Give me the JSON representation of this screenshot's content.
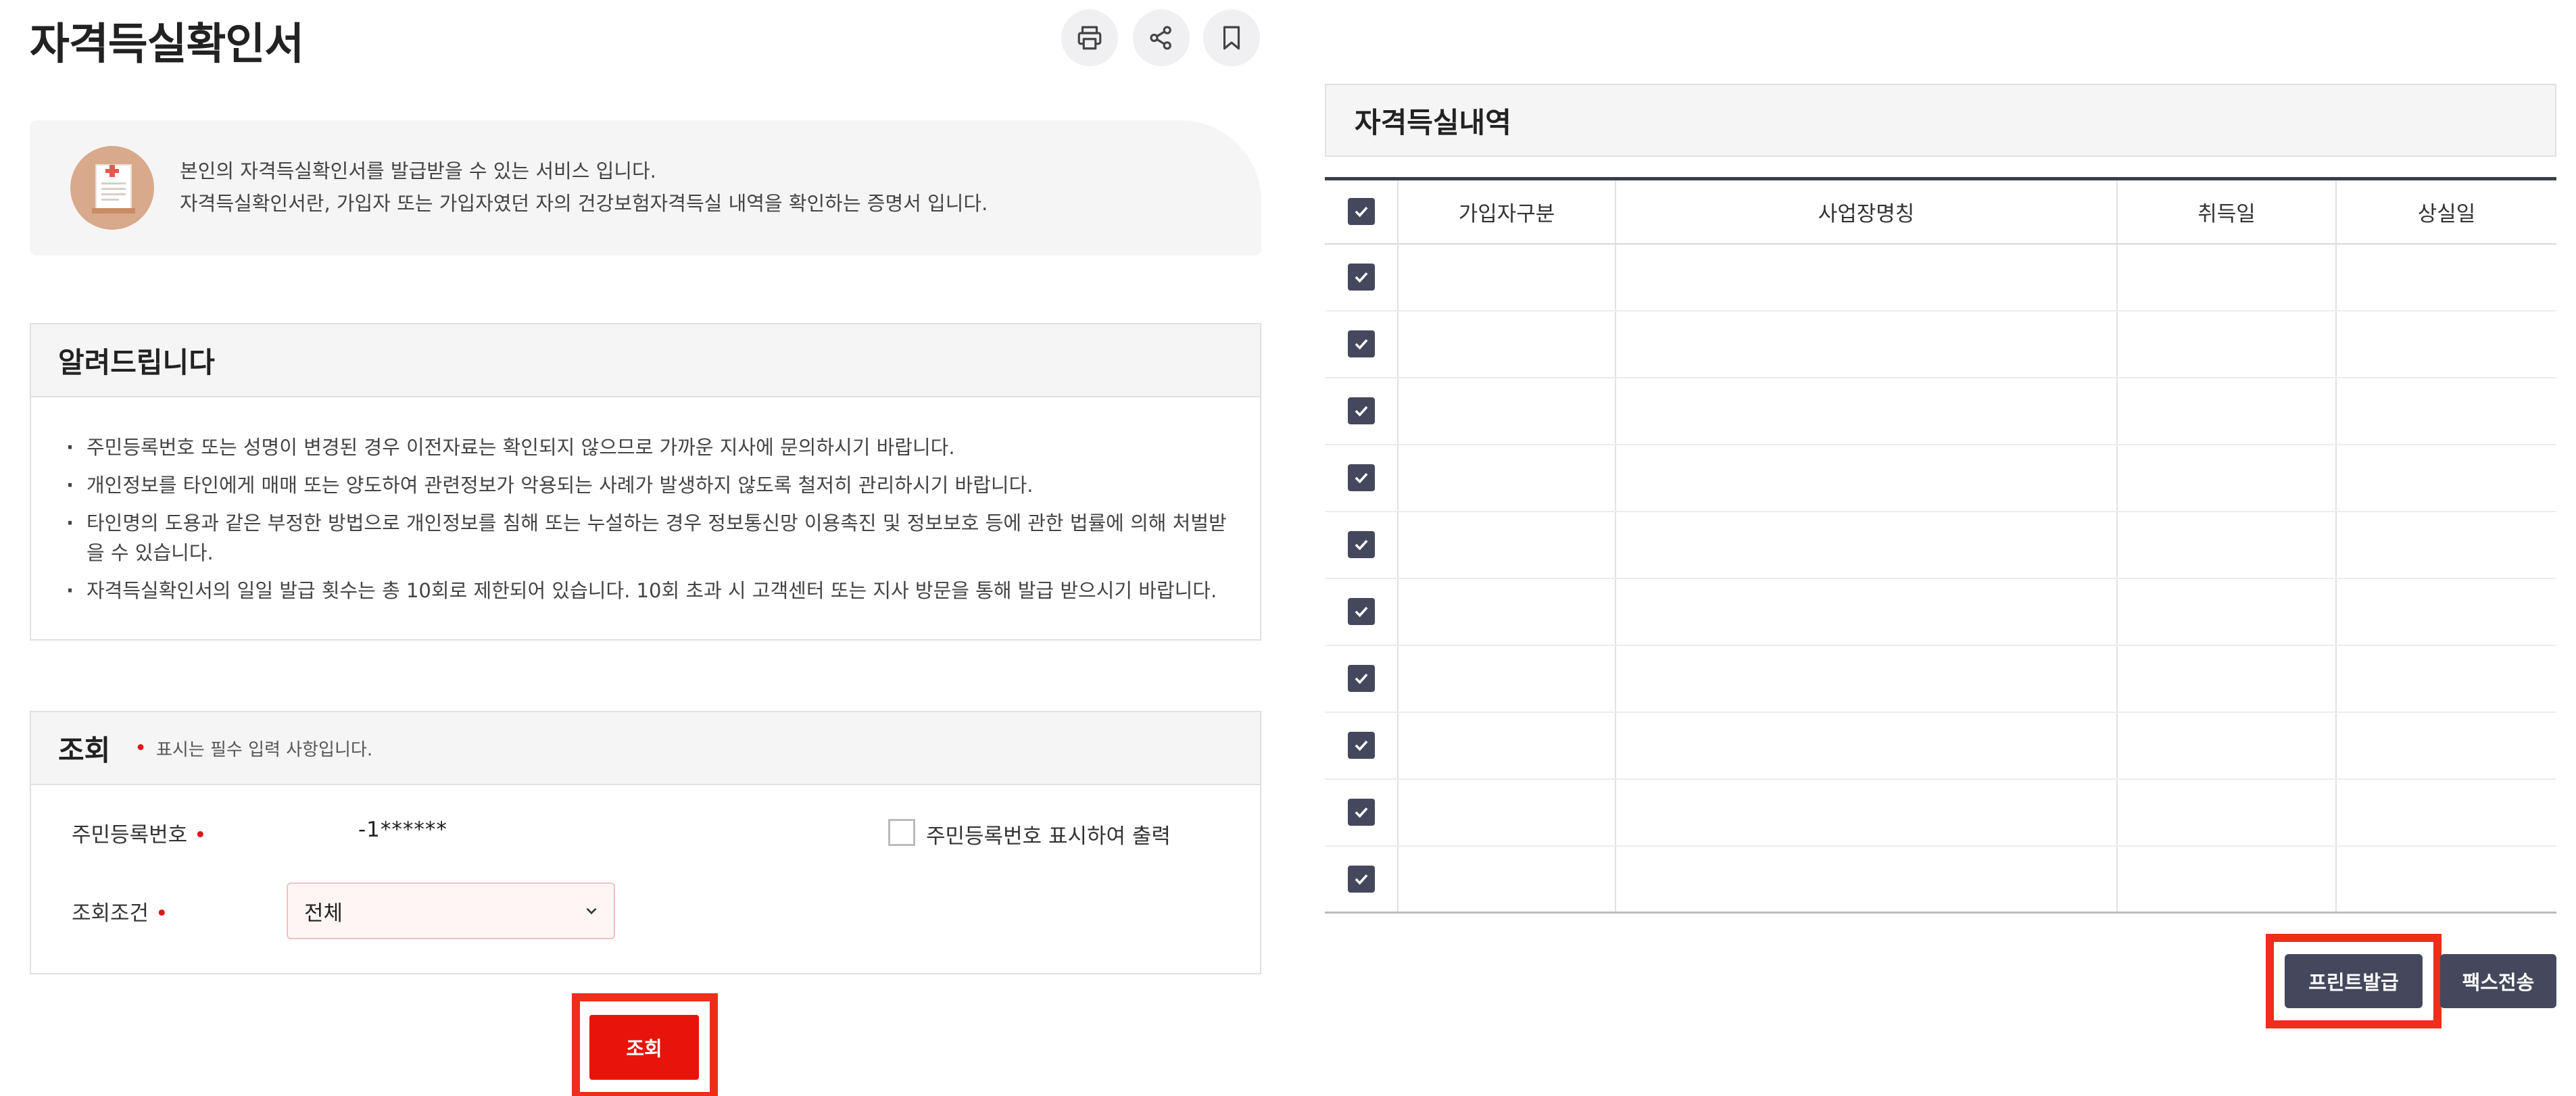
{
  "page": {
    "title": "자격득실확인서",
    "toolbar": [
      {
        "icon": "printer-icon",
        "name": "print-button"
      },
      {
        "icon": "share-icon",
        "name": "share-button"
      },
      {
        "icon": "bookmark-icon",
        "name": "bookmark-button"
      }
    ]
  },
  "intro": {
    "icon": "medical-document-icon",
    "line1": "본인의 자격득실확인서를 발급받을 수 있는 서비스 입니다.",
    "line2": "자격득실확인서란, 가입자 또는 가입자였던 자의 건강보험자격득실 내역을 확인하는 증명서 입니다."
  },
  "notice": {
    "title": "알려드립니다",
    "items": [
      "주민등록번호 또는 성명이 변경된 경우 이전자료는 확인되지 않으므로 가까운 지사에 문의하시기 바랍니다.",
      "개인정보를 타인에게 매매 또는 양도하여 관련정보가 악용되는 사례가 발생하지 않도록 철저히 관리하시기 바랍니다.",
      "타인명의 도용과 같은 부정한 방법으로 개인정보를 침해 또는 누설하는 경우 정보통신망 이용촉진 및 정보보호 등에 관한 법률에 의해 처벌받을 수 있습니다.",
      "자격득실확인서의 일일 발급 횟수는 총 10회로 제한되어 있습니다. 10회 초과 시 고객센터 또는 지사 방문을 통해 발급 받으시기 바랍니다."
    ]
  },
  "query": {
    "title": "조회",
    "required_note": "표시는 필수 입력 사항입니다.",
    "required_mark": "•",
    "rrn_label": "주민등록번호",
    "rrn_value": "-1******",
    "show_rrn_label": "주민등록번호 표시하여 출력",
    "show_rrn_checked": false,
    "condition_label": "조회조건",
    "condition_value": "전체",
    "search_button": "조회"
  },
  "history": {
    "title": "자격득실내역",
    "columns": [
      "가입자구분",
      "사업장명칭",
      "취득일",
      "상실일"
    ],
    "header_checked": true,
    "rows": [
      {
        "checked": true,
        "cells": [
          "",
          "",
          "",
          ""
        ]
      },
      {
        "checked": true,
        "cells": [
          "",
          "",
          "",
          ""
        ]
      },
      {
        "checked": true,
        "cells": [
          "",
          "",
          "",
          ""
        ]
      },
      {
        "checked": true,
        "cells": [
          "",
          "",
          "",
          ""
        ]
      },
      {
        "checked": true,
        "cells": [
          "",
          "",
          "",
          ""
        ]
      },
      {
        "checked": true,
        "cells": [
          "",
          "",
          "",
          ""
        ]
      },
      {
        "checked": true,
        "cells": [
          "",
          "",
          "",
          ""
        ]
      },
      {
        "checked": true,
        "cells": [
          "",
          "",
          "",
          ""
        ]
      },
      {
        "checked": true,
        "cells": [
          "",
          "",
          "",
          ""
        ]
      },
      {
        "checked": true,
        "cells": [
          "",
          "",
          "",
          ""
        ]
      }
    ],
    "print_button": "프린트발급",
    "fax_button": "팩스전송"
  },
  "colors": {
    "accent_red": "#e8140a",
    "highlight_red": "#ee2d1b",
    "dark_button": "#45475c"
  }
}
